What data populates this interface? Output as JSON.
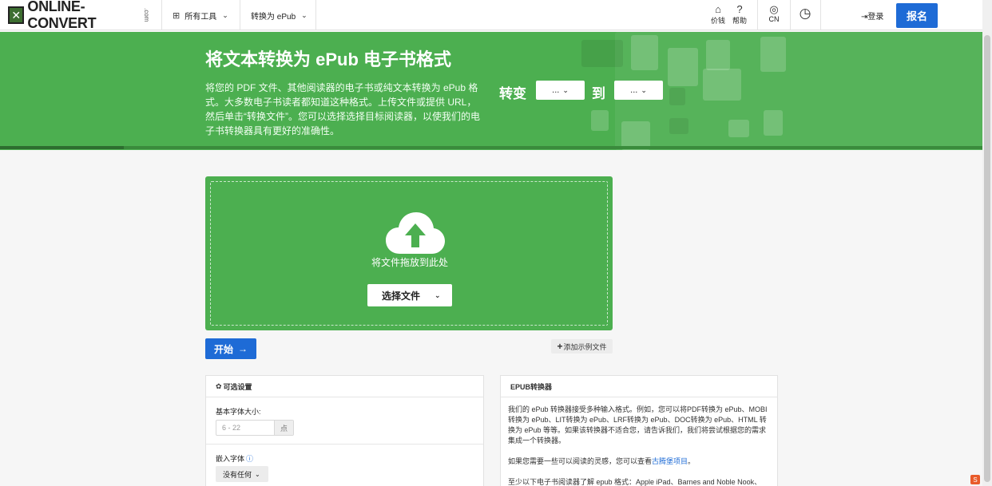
{
  "header": {
    "logo_text": "ONLINE-CONVERT",
    "logo_suffix": ".com",
    "all_tools_label": "所有工具",
    "convert_to_label": "转换为 ePub",
    "pricing_label": "价钱",
    "help_label": "帮助",
    "lang_label": "CN",
    "login_label": "登录",
    "signup_label": "报名"
  },
  "hero": {
    "title": "将文本转换为 ePub 电子书格式",
    "description": "将您的 PDF 文件、其他阅读器的电子书或纯文本转换为 ePub 格式。大多数电子书读者都知道这种格式。上传文件或提供 URL，然后单击“转换文件”。您可以选择选择目标阅读器，以使我们的电子书转换器具有更好的准确性。",
    "convert_label": "转变",
    "to_label": "到",
    "from_select": "...",
    "to_select": "..."
  },
  "upload": {
    "drop_text": "将文件拖放到此处",
    "choose_label": "选择文件"
  },
  "actions": {
    "start_label": "开始",
    "sample_label": "添加示例文件"
  },
  "settings": {
    "title": "可选设置",
    "font_size_label": "基本字体大小:",
    "font_size_placeholder": "6 - 22",
    "font_size_unit": "点",
    "embed_font_label": "嵌入字体",
    "embed_font_value": "没有任何"
  },
  "info": {
    "title": "EPUB转换器",
    "para1": "我们的 ePub 转换器接受多种输入格式。例如，您可以将PDF转换为 ePub、MOBI转换为 ePub、LIT转换为 ePub、LRF转换为 ePub、DOC转换为 ePub、HTML 转换为 ePub 等等。如果该转换器不适合您，请告诉我们，我们将尝试根据您的需求集成一个转换器。",
    "para2_prefix": "如果您需要一些可以阅读的灵感，您可以查看",
    "para2_link": "古腾堡项目",
    "para2_suffix": "。",
    "para3": "至少以下电子书阅读器了解 epub 格式：Apple iPad、Barnes and Noble Nook、"
  },
  "colors": {
    "brand_green": "#4caf50",
    "primary_blue": "#1e6bd6"
  }
}
